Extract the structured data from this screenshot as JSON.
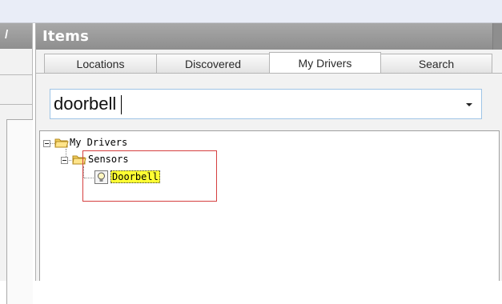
{
  "window": {
    "top_strip_color": "#e9edf7"
  },
  "left_pane": {
    "header_glyph": "/"
  },
  "items_panel": {
    "title": "Items",
    "header_color": "#999999",
    "tabs": [
      {
        "label": "Locations",
        "active": false
      },
      {
        "label": "Discovered",
        "active": false
      },
      {
        "label": "My Drivers",
        "active": true
      },
      {
        "label": "Search",
        "active": false
      }
    ],
    "search": {
      "value": "doorbell",
      "dropdown_icon": "chevron-down-icon"
    }
  },
  "tree": {
    "root": {
      "label": "My Drivers",
      "icon": "folder-icon",
      "expanded": true
    },
    "group": {
      "label": "Sensors",
      "icon": "folder-icon",
      "expanded": true
    },
    "item": {
      "label": "Doorbell",
      "icon": "bulb-icon",
      "selected": true,
      "highlight_color": "#ffff33"
    },
    "annotation_box_color": "#d64040"
  }
}
